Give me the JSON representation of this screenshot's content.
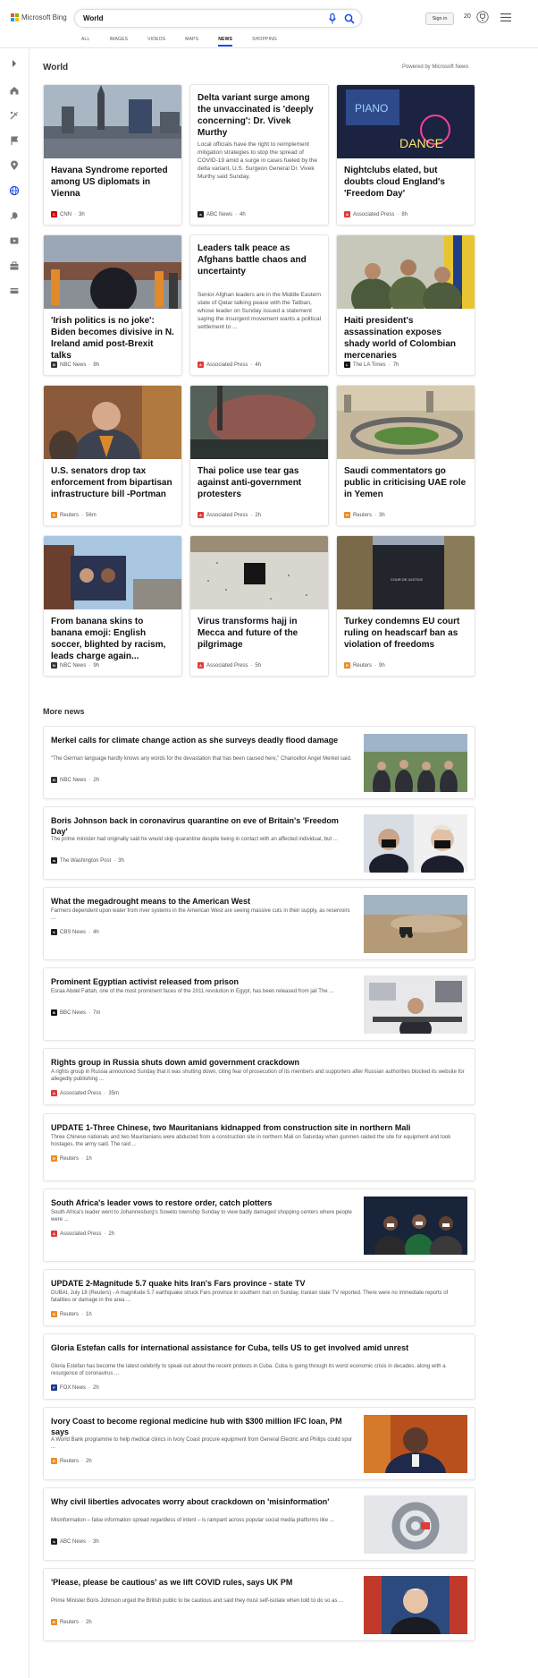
{
  "header": {
    "brand": "Microsoft Bing",
    "search_value": "World",
    "signin": "Sign in",
    "points": "20",
    "tabs": [
      "ALL",
      "IMAGES",
      "VIDEOS",
      "MAPS",
      "NEWS",
      "SHOPPING"
    ],
    "active_tab": "NEWS"
  },
  "section": {
    "title": "World",
    "powered": "Powered by Microsoft News"
  },
  "cards": [
    {
      "title": "Havana Syndrome reported among US diplomats in Vienna",
      "source": "CNN",
      "age": "3h",
      "logo_color": "#cc0000",
      "logo_char": "CNN",
      "img": "city"
    },
    {
      "title": "Delta variant surge among the unvaccinated is 'deeply concerning': Dr. Vivek Murthy",
      "summary": "Local officials have the right to reimplement mitigation strategies to stop the spread of COVID-19 amid a surge in cases fueled by the delta variant, U.S. Surgeon General Dr. Vivek Murthy said Sunday.",
      "source": "ABC News",
      "age": "4h",
      "logo_color": "#222222",
      "logo_char": "a"
    },
    {
      "title": "Nightclubs elated, but doubts cloud England's 'Freedom Day'",
      "source": "Associated Press",
      "age": "8h",
      "logo_color": "#e03a3a",
      "logo_char": "AP",
      "img": "club"
    },
    {
      "title": "'Irish politics is no joke': Biden becomes divisive in N. Ireland amid post-Brexit talks",
      "source": "NBC News",
      "age": "8h",
      "logo_color": "#333333",
      "logo_char": "N",
      "img": "parade"
    },
    {
      "title": "Leaders talk peace as Afghans battle chaos and uncertainty",
      "summary": "Senior Afghan leaders are in the Middle Eastern state of Qatar talking peace with the Taliban, whose leader on Sunday issued a statement saying the insurgent movement wants a political settlement to ...",
      "source": "Associated Press",
      "age": "4h",
      "logo_color": "#e03a3a",
      "logo_char": "AP"
    },
    {
      "title": "Haiti president's assassination exposes shady world of Colombian mercenaries",
      "source": "The LA Times",
      "age": "7h",
      "logo_color": "#111111",
      "logo_char": "L",
      "img": "soldiers"
    },
    {
      "title": "U.S. senators drop tax enforcement from bipartisan infrastructure bill -Portman",
      "source": "Reuters",
      "age": "56m",
      "logo_color": "#f08a24",
      "logo_char": "R",
      "img": "senator"
    },
    {
      "title": "Thai police use tear gas against anti-government protesters",
      "source": "Associated Press",
      "age": "2h",
      "logo_color": "#e03a3a",
      "logo_char": "AP",
      "img": "teargas"
    },
    {
      "title": "Saudi commentators go public in criticising UAE role in Yemen",
      "source": "Reuters",
      "age": "3h",
      "logo_color": "#f08a24",
      "logo_char": "R",
      "img": "highway"
    },
    {
      "title": "From banana skins to banana emoji: English soccer, blighted by racism, leads charge again...",
      "source": "NBC News",
      "age": "9h",
      "logo_color": "#333333",
      "logo_char": "N",
      "img": "mural"
    },
    {
      "title": "Virus transforms hajj in Mecca and future of the pilgrimage",
      "source": "Associated Press",
      "age": "5h",
      "logo_color": "#e03a3a",
      "logo_char": "AP",
      "img": "mecca"
    },
    {
      "title": "Turkey condemns EU court ruling on headscarf ban as violation of freedoms",
      "source": "Reuters",
      "age": "9h",
      "logo_color": "#f08a24",
      "logo_char": "R",
      "img": "court"
    }
  ],
  "more_news": {
    "title": "More news",
    "items": [
      {
        "title": "Merkel calls for climate change action as she surveys deadly flood damage",
        "summary": "\"The German language hardly knows any words for the devastation that has been caused here,\" Chancellor Angel Merkel said.",
        "source": "NBC News",
        "age": "2h",
        "logo_color": "#333333",
        "logo_char": "N",
        "img": "merkel"
      },
      {
        "title": "Boris Johnson back in coronavirus quarantine on eve of Britain's 'Freedom Day'",
        "summary": "The prime minister had originally said he would skip quarantine despite being in contact with an affected individual, but ...",
        "source": "The Washington Post",
        "age": "3h",
        "logo_color": "#222222",
        "logo_char": "wp",
        "img": "masks"
      },
      {
        "title": "What the megadrought means to the American West",
        "summary": "Farmers dependent upon water from river systems in the American West are seeing massive cuts in their supply, as reservoirs ...",
        "source": "CBS News",
        "age": "4h",
        "logo_color": "#222222",
        "logo_char": "●",
        "img": "drought"
      },
      {
        "title": "Prominent Egyptian activist released from prison",
        "summary": "Esraa Abdel Fattah, one of the most prominent faces of the 2011 revolution in Egypt, has been released from jail The ...",
        "source": "BBC News",
        "age": "7m",
        "logo_color": "#111111",
        "logo_char": "B",
        "img": "office"
      },
      {
        "title": "Rights group in Russia shuts down amid government crackdown",
        "summary": "A rights group in Russia announced Sunday that it was shutting down, citing fear of prosecution of its members and supporters after Russian authorities blocked its website for allegedly publishing ...",
        "source": "Associated Press",
        "age": "35m",
        "logo_color": "#e03a3a",
        "logo_char": "AP"
      },
      {
        "title": "UPDATE 1-Three Chinese, two Mauritanians kidnapped from construction site in northern Mali",
        "summary": "Three Chinese nationals and two Mauritanians were abducted from a construction site in northern Mali on Saturday when gunmen raided the site for equipment and took hostages, the army said. The raid ...",
        "source": "Reuters",
        "age": "1h",
        "logo_color": "#f08a24",
        "logo_char": "R"
      },
      {
        "title": "South Africa's leader vows to restore order, catch plotters",
        "summary": "South Africa's leader went to Johannesburg's Soweto township Sunday to view badly damaged shopping centers where people were ...",
        "source": "Associated Press",
        "age": "2h",
        "logo_color": "#e03a3a",
        "logo_char": "AP",
        "img": "ramaphosa"
      },
      {
        "title": "UPDATE 2-Magnitude 5.7 quake hits Iran's Fars province - state TV",
        "summary": "DUBAI, July 18 (Reuters) - A magnitude 5.7 earthquake struck Fars province in southern Iran on Sunday, Iranian state TV reported. There were no immediate reports of fatalities or damage in the area ...",
        "source": "Reuters",
        "age": "1h",
        "logo_color": "#f08a24",
        "logo_char": "R"
      },
      {
        "title": "Gloria Estefan calls for international assistance for Cuba, tells US to get involved amid unrest",
        "summary": "Gloria Estefan has become the latest celebrity to speak out about the recent protests in Cuba.  Cuba is going through its worst economic crisis in decades, along with a resurgence of coronavirus ...",
        "source": "FOX News",
        "age": "2h",
        "logo_color": "#1a3a8a",
        "logo_char": "F"
      },
      {
        "title": "Ivory Coast to become regional medicine hub with $300 million IFC loan, PM says",
        "summary": "A World Bank programme to help medical clinics in Ivory Coast procure equipment from General Electric and Philips could spur ...",
        "source": "Reuters",
        "age": "2h",
        "logo_color": "#f08a24",
        "logo_char": "R",
        "img": "pm"
      },
      {
        "title": "Why civil liberties advocates worry about crackdown on 'misinformation'",
        "summary": "Misinformation – false information spread regardless of intent – is rampant across popular social media platforms like ...",
        "source": "ABC News",
        "age": "3h",
        "logo_color": "#222222",
        "logo_char": "a",
        "img": "atsign"
      },
      {
        "title": "'Please, please be cautious' as we lift COVID rules, says UK PM",
        "summary": "Prime Minister Boris Johnson urged the British public to be cautious and said they must self-isolate when told to do so as ...",
        "source": "Reuters",
        "age": "2h",
        "logo_color": "#f08a24",
        "logo_char": "R",
        "img": "boris"
      }
    ]
  }
}
